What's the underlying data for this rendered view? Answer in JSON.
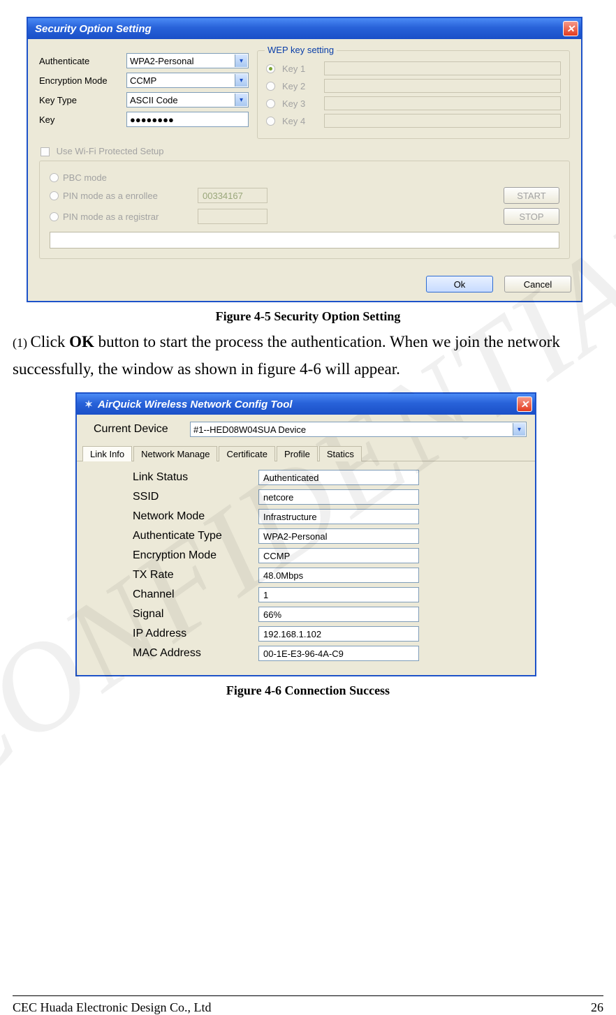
{
  "watermark": "CONFIDENTIAL",
  "window1": {
    "title": "Security Option Setting",
    "fields": {
      "authenticate": {
        "label": "Authenticate",
        "value": "WPA2-Personal"
      },
      "encryption": {
        "label": "Encryption Mode",
        "value": "CCMP"
      },
      "keytype": {
        "label": "Key Type",
        "value": "ASCII Code"
      },
      "key": {
        "label": "Key",
        "value": "●●●●●●●●"
      }
    },
    "wep": {
      "legend": "WEP key setting",
      "key1": "Key 1",
      "key2": "Key 2",
      "key3": "Key 3",
      "key4": "Key 4"
    },
    "wps": {
      "checkbox_label": "Use Wi-Fi Protected Setup",
      "pbc": "PBC mode",
      "pin_enrollee": "PIN mode as a enrollee",
      "pin_registrar": "PIN mode as a registrar",
      "pin_value": "00334167",
      "start": "START",
      "stop": "STOP"
    },
    "ok": "Ok",
    "cancel": "Cancel"
  },
  "caption1": "Figure 4-5 Security Option Setting",
  "paragraph": {
    "prefix": "(1) ",
    "pre": "Click ",
    "bold": "OK",
    "post": " button to start the process the authentication. When we join the network successfully, the window as shown in figure 4-6 will appear."
  },
  "window2": {
    "title": "AirQuick Wireless Network Config Tool",
    "current_device_label": "Current Device",
    "current_device_value": "#1--HED08W04SUA Device",
    "tabs": [
      "Link Info",
      "Network Manage",
      "Certificate",
      "Profile",
      "Statics"
    ],
    "info": [
      {
        "label": "Link Status",
        "value": "Authenticated"
      },
      {
        "label": "SSID",
        "value": "netcore"
      },
      {
        "label": "Network Mode",
        "value": "Infrastructure"
      },
      {
        "label": "Authenticate Type",
        "value": "WPA2-Personal"
      },
      {
        "label": "Encryption Mode",
        "value": "CCMP"
      },
      {
        "label": "TX Rate",
        "value": "48.0Mbps"
      },
      {
        "label": "Channel",
        "value": "1"
      },
      {
        "label": "Signal",
        "value": "66%"
      },
      {
        "label": "IP Address",
        "value": "192.168.1.102"
      },
      {
        "label": "MAC Address",
        "value": "00-1E-E3-96-4A-C9"
      }
    ]
  },
  "caption2": "Figure 4-6 Connection Success",
  "footer": {
    "company": "CEC Huada Electronic Design Co., Ltd",
    "page": "26"
  }
}
